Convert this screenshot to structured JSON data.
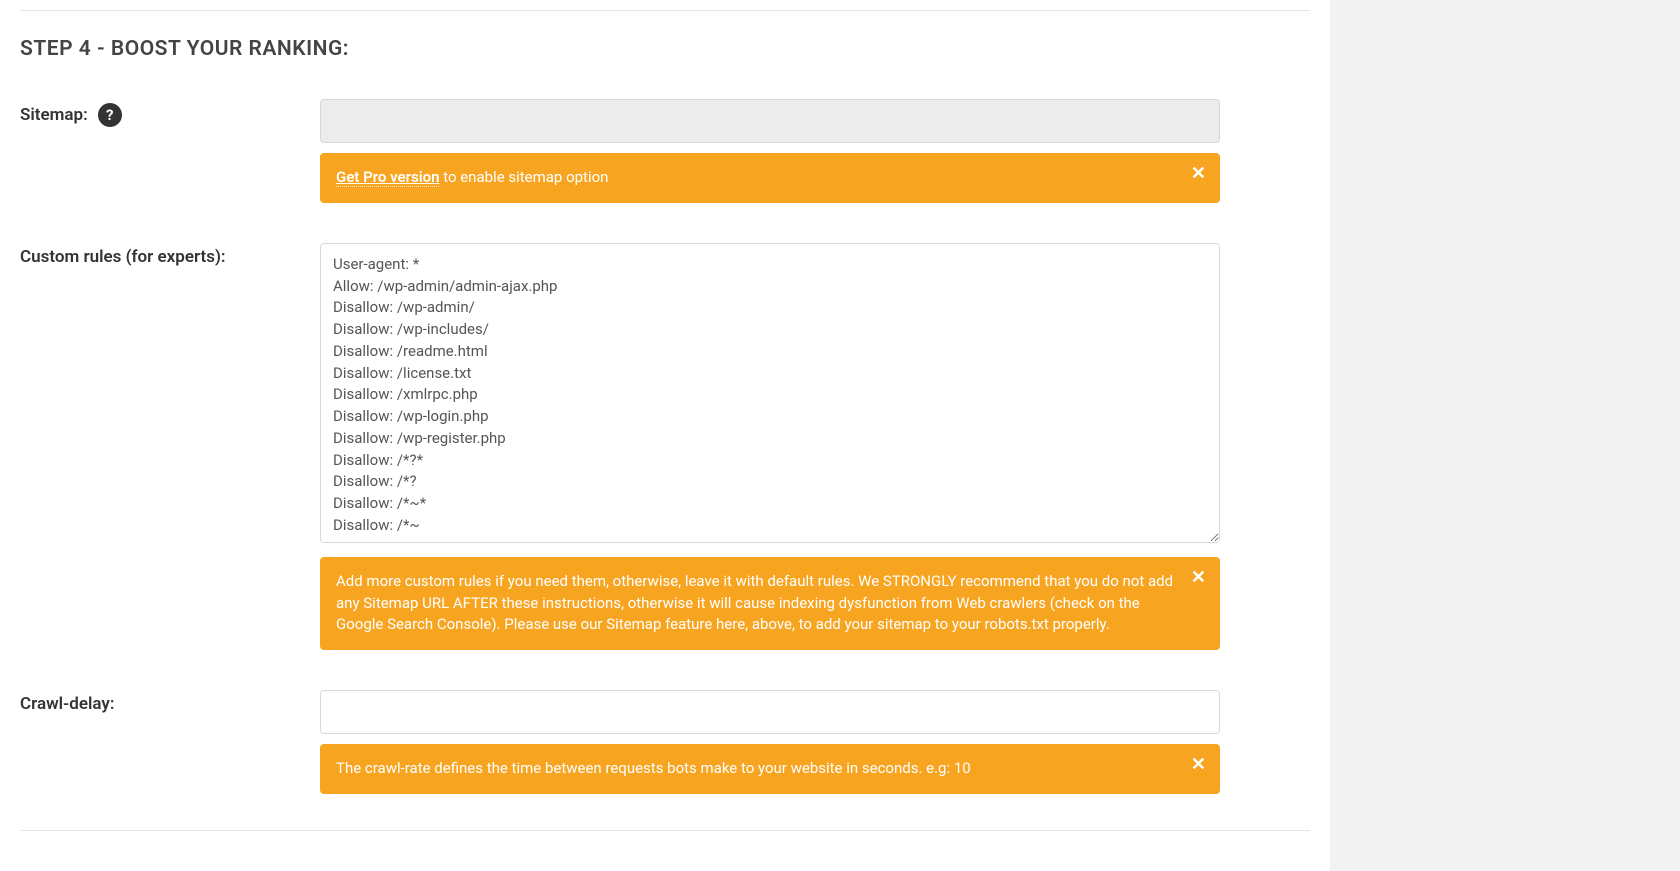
{
  "step_heading": "STEP 4 - BOOST YOUR RANKING:",
  "sitemap": {
    "label": "Sitemap:",
    "value": "",
    "notice_link": "Get Pro version",
    "notice_text": " to enable sitemap option"
  },
  "custom_rules": {
    "label": "Custom rules (for experts):",
    "value": "User-agent: *\nAllow: /wp-admin/admin-ajax.php\nDisallow: /wp-admin/\nDisallow: /wp-includes/\nDisallow: /readme.html\nDisallow: /license.txt\nDisallow: /xmlrpc.php\nDisallow: /wp-login.php\nDisallow: /wp-register.php\nDisallow: /*?*\nDisallow: /*?\nDisallow: /*~*\nDisallow: /*~",
    "notice": "Add more custom rules if you need them, otherwise, leave it with default rules. We STRONGLY recommend that you do not add any Sitemap URL AFTER these instructions, otherwise it will cause indexing dysfunction from Web crawlers (check on the Google Search Console). Please use our Sitemap feature here, above, to add your sitemap to your robots.txt properly."
  },
  "crawl_delay": {
    "label": "Crawl-delay:",
    "value": "",
    "notice": "The crawl-rate defines the time between requests bots make to your website in seconds. e.g: 10"
  },
  "icons": {
    "help": "?",
    "close": "✕"
  }
}
